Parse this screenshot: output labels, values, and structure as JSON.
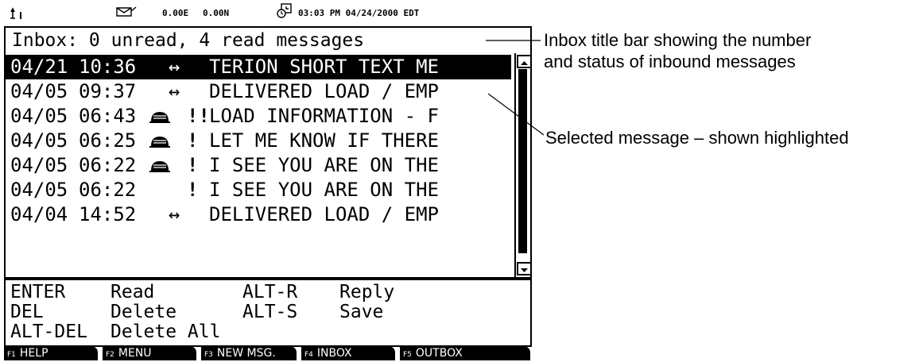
{
  "status_bar": {
    "position_e": "0.00E",
    "position_n": "0.00N",
    "datetime": "03:03 PM 04/24/2000 EDT"
  },
  "icons": {
    "antenna": "antenna-signal-icon",
    "mail": "mail-icon",
    "clock": "clock-icon",
    "envelope": "envelope-icon",
    "arrow": "arrow-icon",
    "priority": "priority-icon"
  },
  "inbox": {
    "title": "Inbox: 0 unread, 4 read messages",
    "messages": [
      {
        "date": "04/21",
        "time": "10:36",
        "icon": "arrow",
        "priority": "",
        "arrow": "↔",
        "subject": "TERION SHORT TEXT ME",
        "selected": true
      },
      {
        "date": "04/05",
        "time": "09:37",
        "icon": "arrow",
        "priority": "",
        "arrow": "↔",
        "subject": "DELIVERED LOAD / EMP",
        "selected": false
      },
      {
        "date": "04/05",
        "time": "06:43",
        "icon": "envelope",
        "priority": "!!",
        "arrow": "",
        "subject": "LOAD INFORMATION - F",
        "selected": false
      },
      {
        "date": "04/05",
        "time": "06:25",
        "icon": "envelope",
        "priority": "!",
        "arrow": "",
        "subject": "LET ME KNOW IF THERE",
        "selected": false
      },
      {
        "date": "04/05",
        "time": "06:22",
        "icon": "envelope",
        "priority": "!",
        "arrow": "",
        "subject": "I SEE YOU ARE ON THE",
        "selected": false
      },
      {
        "date": "04/05",
        "time": "06:22",
        "icon": "",
        "priority": "!",
        "arrow": "",
        "subject": "I SEE YOU ARE ON THE",
        "selected": false
      },
      {
        "date": "04/04",
        "time": "14:52",
        "icon": "arrow",
        "priority": "",
        "arrow": "↔",
        "subject": "DELIVERED LOAD / EMP",
        "selected": false
      }
    ]
  },
  "keys": {
    "enter_key": "ENTER",
    "enter_action": "Read",
    "del_key": "DEL",
    "del_action": "Delete",
    "altdel_key": "ALT-DEL",
    "altdel_action": "Delete All",
    "altr_key": "ALT-R",
    "altr_action": "Reply",
    "alts_key": "ALT-S",
    "alts_action": "Save"
  },
  "function_keys": [
    {
      "fn": "F1",
      "label": "HELP"
    },
    {
      "fn": "F2",
      "label": "MENU"
    },
    {
      "fn": "F3",
      "label": "NEW MSG."
    },
    {
      "fn": "F4",
      "label": "INBOX"
    },
    {
      "fn": "F5",
      "label": "OUTBOX"
    }
  ],
  "annotations": {
    "title_line1": "Inbox title bar showing the number",
    "title_line2": "and status of inbound messages",
    "selected": "Selected message – shown highlighted"
  }
}
